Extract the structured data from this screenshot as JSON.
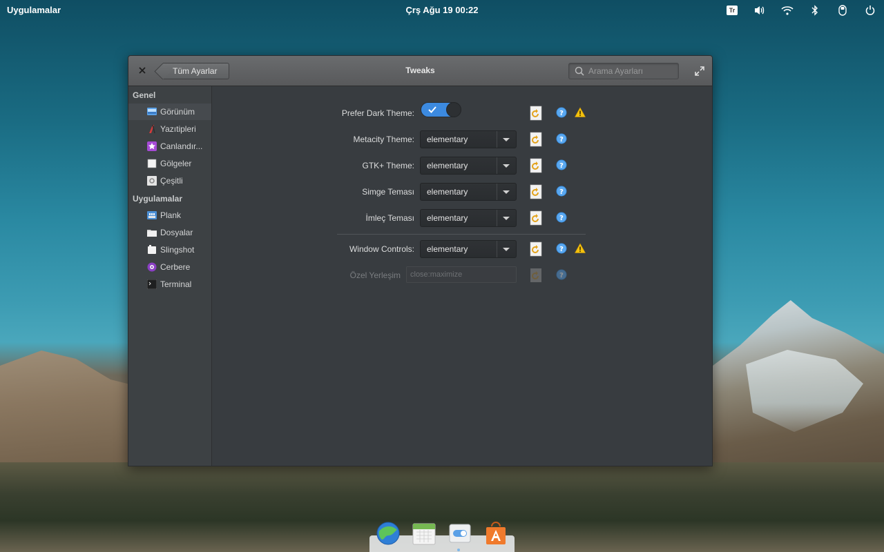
{
  "panel": {
    "apps_label": "Uygulamalar",
    "clock": "Çrş Ağu 19 00:22",
    "keyboard_layout": "Tr",
    "tray_icons": [
      "keyboard-layout-indicator",
      "volume-icon",
      "wifi-icon",
      "bluetooth-icon",
      "mouse-icon",
      "power-icon"
    ]
  },
  "window": {
    "title": "Tweaks",
    "back_label": "Tüm Ayarlar",
    "search_placeholder": "Arama Ayarları"
  },
  "sidebar": {
    "sections": [
      {
        "header": "Genel",
        "items": [
          {
            "label": "Görünüm",
            "icon": "appearance-icon",
            "selected": true
          },
          {
            "label": "Yazıtipleri",
            "icon": "fonts-icon"
          },
          {
            "label": "Canlandır...",
            "icon": "animations-icon"
          },
          {
            "label": "Gölgeler",
            "icon": "shadows-icon"
          },
          {
            "label": "Çeşitli",
            "icon": "misc-icon"
          }
        ]
      },
      {
        "header": "Uygulamalar",
        "items": [
          {
            "label": "Plank",
            "icon": "plank-icon"
          },
          {
            "label": "Dosyalar",
            "icon": "files-icon"
          },
          {
            "label": "Slingshot",
            "icon": "slingshot-icon"
          },
          {
            "label": "Cerbere",
            "icon": "cerbere-icon"
          },
          {
            "label": "Terminal",
            "icon": "terminal-icon"
          }
        ]
      }
    ]
  },
  "settings": {
    "prefer_dark": {
      "label": "Prefer Dark Theme:",
      "enabled": true
    },
    "metacity": {
      "label": "Metacity Theme:",
      "value": "elementary"
    },
    "gtk": {
      "label": "GTK+ Theme:",
      "value": "elementary"
    },
    "icon_theme": {
      "label": "Simge Teması",
      "value": "elementary"
    },
    "cursor_theme": {
      "label": "İmleç Teması",
      "value": "elementary"
    },
    "window_controls": {
      "label": "Window Controls:",
      "value": "elementary"
    },
    "custom_layout": {
      "label": "Özel Yerleşim",
      "value": "close:maximize",
      "disabled": true
    }
  },
  "dock": {
    "items": [
      "browser-icon",
      "calendar-icon",
      "switchboard-icon",
      "appcenter-icon"
    ]
  },
  "colors": {
    "accent": "#3c8ae0",
    "warning": "#f4c20d",
    "help": "#3a8fe0"
  }
}
